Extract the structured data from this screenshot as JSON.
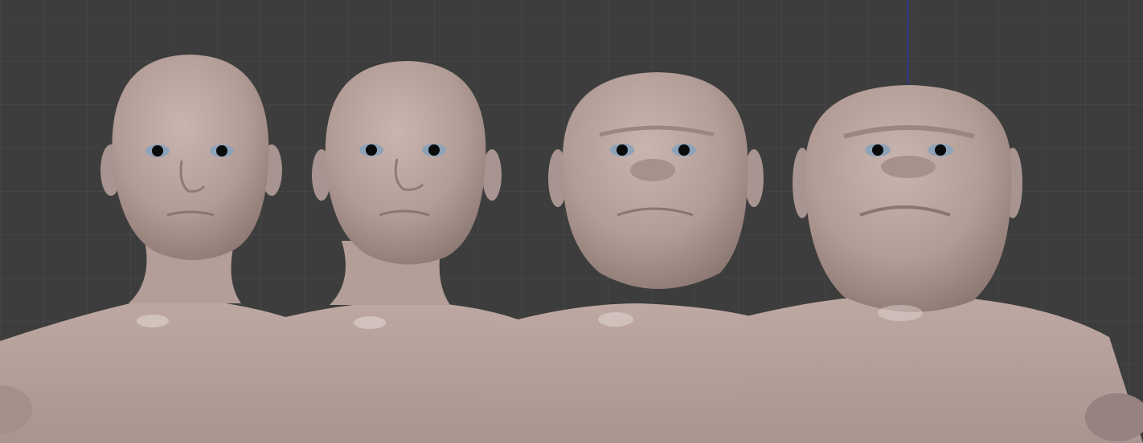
{
  "viewport": {
    "background": "#3d3d3d",
    "grid": true,
    "axis_color": "#2b2bd8",
    "skin_color": "#b9a39d"
  },
  "models": [
    {
      "id": "model-1",
      "variant": "human"
    },
    {
      "id": "model-2",
      "variant": "human-heavier"
    },
    {
      "id": "model-3",
      "variant": "heavy-brow"
    },
    {
      "id": "model-4",
      "variant": "ape-like"
    }
  ]
}
